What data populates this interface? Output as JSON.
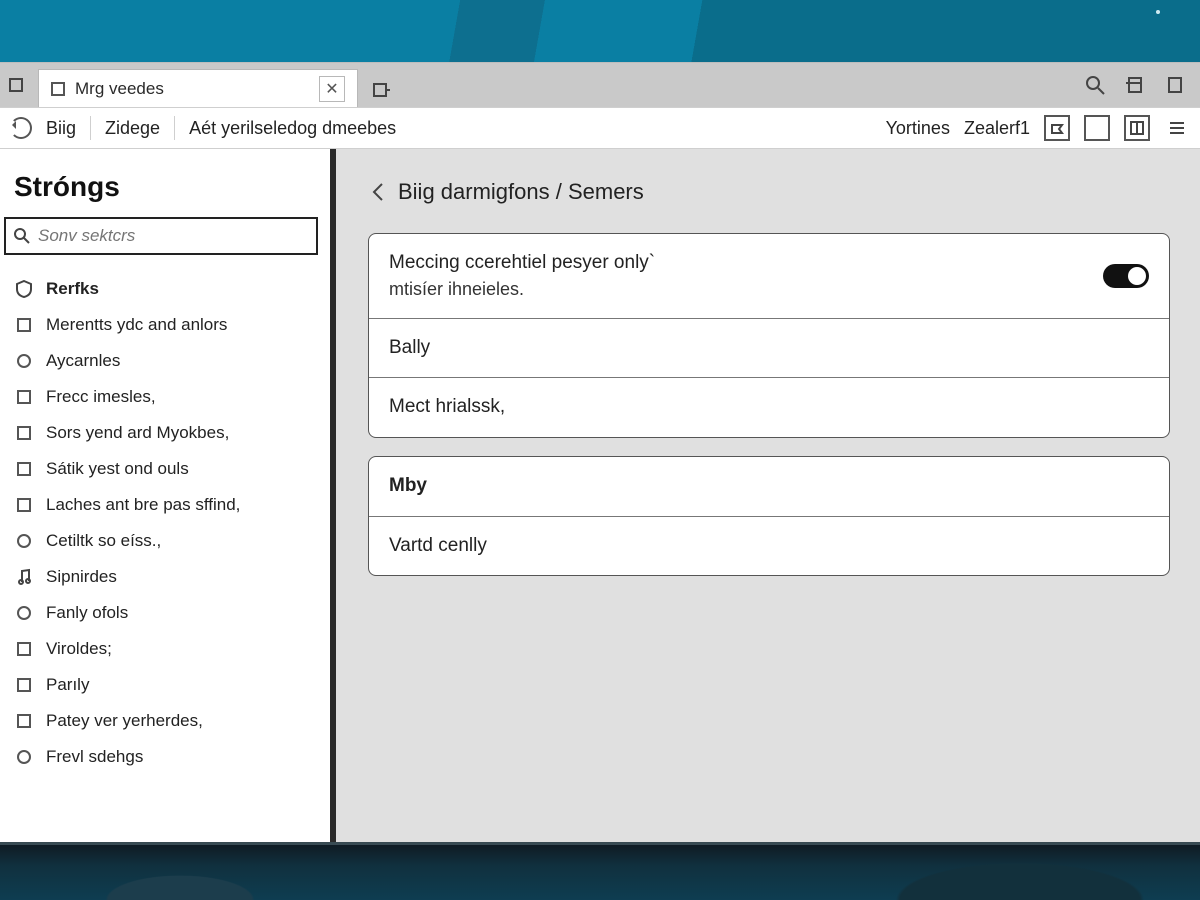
{
  "tab": {
    "title": "Mrg veedes"
  },
  "tabstrip_icons": {
    "search": "search-icon",
    "panel": "panel-icon",
    "menu": "menu-icon"
  },
  "toolbar": {
    "crumbs": [
      "Biig",
      "Zidege",
      "Aét yerilseledog dmeebes"
    ],
    "right": [
      "Yortines",
      "Zealerf1"
    ]
  },
  "sidebar": {
    "heading": "Stróngs",
    "search_placeholder": "Sonv sektcrs",
    "items": [
      {
        "label": "Rerfks",
        "active": true,
        "icon": "shield"
      },
      {
        "label": "Merentts ydc and anlors",
        "icon": "box"
      },
      {
        "label": "Aycarnles",
        "icon": "circ"
      },
      {
        "label": "Frecc imesles,",
        "icon": "box"
      },
      {
        "label": "Sors yend ard Myokbes,",
        "icon": "box"
      },
      {
        "label": "Sátik yest ond ouls",
        "icon": "box"
      },
      {
        "label": "Laches ant bre pas sffind,",
        "icon": "box"
      },
      {
        "label": "Cetiltk so eíss.,",
        "icon": "circ"
      },
      {
        "label": "Sipnirdes",
        "icon": "note"
      },
      {
        "label": "Fanly ofols",
        "icon": "circ"
      },
      {
        "label": "Viroldes;",
        "icon": "box"
      },
      {
        "label": "Parıly",
        "icon": "box"
      },
      {
        "label": "Patey ver yerherdes,",
        "icon": "box"
      },
      {
        "label": "Frevl sdehgs",
        "icon": "circ"
      }
    ]
  },
  "content": {
    "breadcrumb": "Biig darmigfons / Semers",
    "group1": {
      "row1_line1": "Meccing ccerehtiel pesyer only`",
      "row1_line2": "mtisíer ihneieles.",
      "row2": "Bally",
      "row3": "Mect hrialssk,"
    },
    "group2": {
      "header": "Mby",
      "row2": "Vartd cenlly"
    }
  }
}
